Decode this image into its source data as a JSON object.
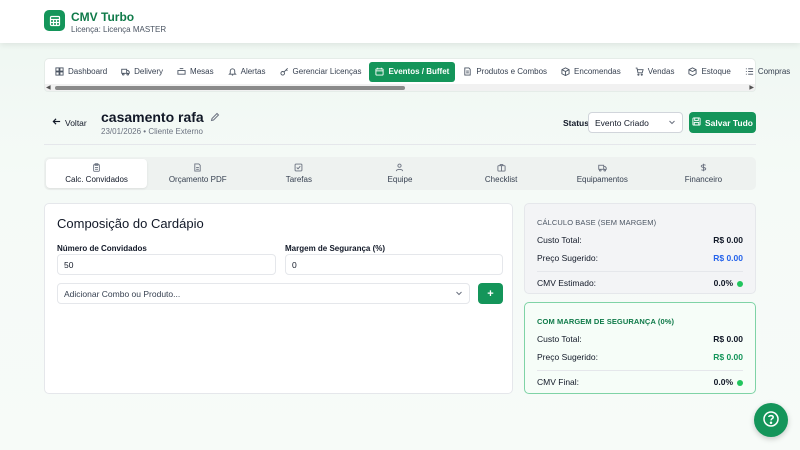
{
  "app": {
    "title": "CMV Turbo",
    "license": "Licença: Licença MASTER"
  },
  "nav": {
    "tabs": [
      {
        "label": "Dashboard",
        "icon": "grid-icon"
      },
      {
        "label": "Delivery",
        "icon": "truck-icon"
      },
      {
        "label": "Mesas",
        "icon": "table-icon"
      },
      {
        "label": "Alertas",
        "icon": "bell-icon"
      },
      {
        "label": "Gerenciar Licenças",
        "icon": "key-icon"
      },
      {
        "label": "Eventos / Buffet",
        "icon": "calendar-icon",
        "active": true
      },
      {
        "label": "Produtos e Combos",
        "icon": "document-icon"
      },
      {
        "label": "Encomendas",
        "icon": "package-icon"
      },
      {
        "label": "Vendas",
        "icon": "cart-icon"
      },
      {
        "label": "Estoque",
        "icon": "box-icon"
      },
      {
        "label": "Compras",
        "icon": "list-icon"
      }
    ]
  },
  "event": {
    "back_label": "Voltar",
    "title": "casamento rafa",
    "date": "23/01/2026",
    "client": "Cliente Externo",
    "status_label": "Status:",
    "status_value": "Evento Criado",
    "save_label": "Salvar Tudo"
  },
  "sub_tabs": [
    {
      "label": "Calc. Convidados",
      "icon": "clipboard-icon",
      "active": true
    },
    {
      "label": "Orçamento PDF",
      "icon": "file-icon"
    },
    {
      "label": "Tarefas",
      "icon": "check-square-icon"
    },
    {
      "label": "Equipe",
      "icon": "users-icon"
    },
    {
      "label": "Checklist",
      "icon": "briefcase-icon"
    },
    {
      "label": "Equipamentos",
      "icon": "truck-icon"
    },
    {
      "label": "Financeiro",
      "icon": "dollar-icon"
    }
  ],
  "composition": {
    "title": "Composição do Cardápio",
    "guests_label": "Número de Convidados",
    "guests_value": "50",
    "margin_label": "Margem de Segurança (%)",
    "margin_value": "0",
    "product_placeholder": "Adicionar Combo ou Produto...",
    "add_label": "+"
  },
  "calc_base": {
    "heading": "CÁLCULO BASE (SEM MARGEM)",
    "total_cost_label": "Custo Total:",
    "total_cost_value": "R$ 0.00",
    "suggested_label": "Preço Sugerido:",
    "suggested_value": "R$ 0.00",
    "cmv_label": "CMV Estimado:",
    "cmv_value": "0.0%"
  },
  "calc_margin": {
    "heading": "COM MARGEM DE SEGURANÇA (0%)",
    "total_cost_label": "Custo Total:",
    "total_cost_value": "R$ 0.00",
    "suggested_label": "Preço Sugerido:",
    "suggested_value": "R$ 0.00",
    "cmv_label": "CMV Final:",
    "cmv_value": "0.0%"
  },
  "colors": {
    "brand": "#14955a",
    "blue_value": "#2563eb",
    "status_dot": "#22c55e"
  }
}
